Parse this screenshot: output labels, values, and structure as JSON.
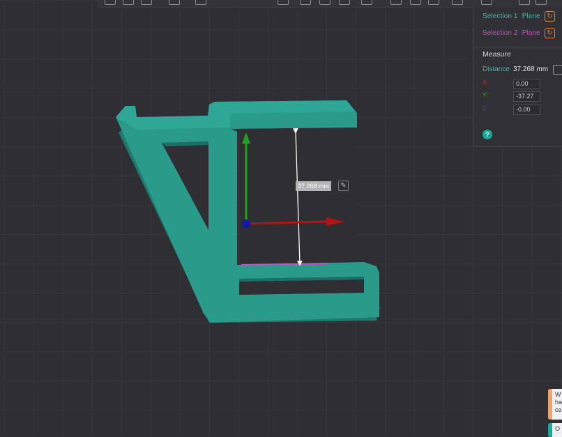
{
  "selections": [
    {
      "label": "Selection 1",
      "type": "Plane",
      "color": "#3fb9aa"
    },
    {
      "label": "Selection 2",
      "type": "Plane",
      "color": "#c44fc6"
    }
  ],
  "measure": {
    "title": "Measure",
    "distance_label": "Distance",
    "distance_value": "37.268 mm",
    "x_label": "X:",
    "x_value": "0.00",
    "y_label": "Y:",
    "y_value": "-37.27",
    "z_label": "Z:",
    "z_value": "-0.00",
    "help_symbol": "?"
  },
  "viewport": {
    "dimension_label": "37.268 mm",
    "model_color": "#2a9a8a"
  },
  "notifications": [
    {
      "text": "W\nha\nce"
    },
    {
      "text": "O"
    }
  ],
  "icons": {
    "reset": "reset-icon",
    "copy": "copy-icon",
    "edit": "edit-icon",
    "help": "help-icon"
  }
}
